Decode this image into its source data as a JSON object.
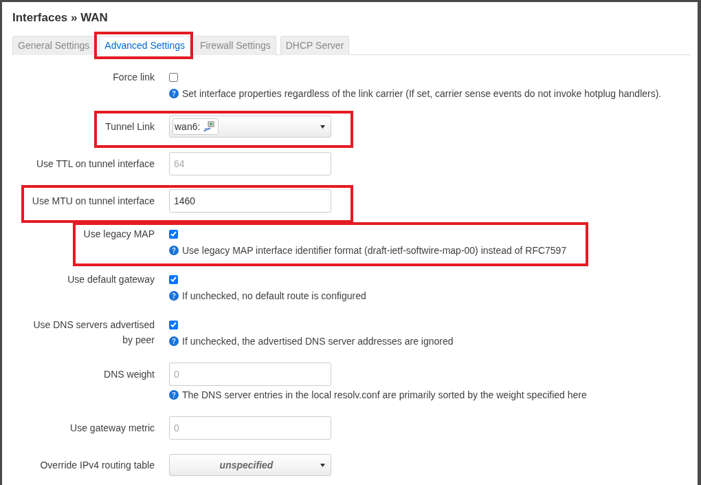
{
  "title": "Interfaces » WAN",
  "tabs": [
    {
      "label": "General Settings",
      "selected": false,
      "highlighted": false
    },
    {
      "label": "Advanced Settings",
      "selected": true,
      "highlighted": true
    },
    {
      "label": "Firewall Settings",
      "selected": false,
      "highlighted": false
    },
    {
      "label": "DHCP Server",
      "selected": false,
      "highlighted": false
    }
  ],
  "fields": [
    {
      "label": "Force link",
      "kind": "checkbox",
      "checked": false,
      "highlighted": false,
      "help": "Set interface properties regardless of the link carrier (If set, carrier sense events do not invoke hotplug handlers)."
    },
    {
      "label": "Tunnel Link",
      "kind": "select",
      "chip": "wan6:",
      "highlighted": true
    },
    {
      "label": "Use TTL on tunnel interface",
      "kind": "text",
      "placeholder": "64",
      "highlighted": false
    },
    {
      "label": "Use MTU on tunnel interface",
      "kind": "text",
      "value": "1460",
      "highlighted": true
    },
    {
      "label": "Use legacy MAP",
      "kind": "checkbox",
      "checked": true,
      "highlighted": true,
      "help": "Use legacy MAP interface identifier format (draft-ietf-softwire-map-00) instead of RFC7597"
    },
    {
      "label": "Use default gateway",
      "kind": "checkbox",
      "checked": true,
      "highlighted": false,
      "help": "If unchecked, no default route is configured"
    },
    {
      "label": "Use DNS servers advertised by peer",
      "kind": "checkbox",
      "checked": true,
      "highlighted": false,
      "help": "If unchecked, the advertised DNS server addresses are ignored"
    },
    {
      "label": "DNS weight",
      "kind": "text",
      "placeholder": "0",
      "highlighted": false,
      "help": "The DNS server entries in the local resolv.conf are primarily sorted by the weight specified here"
    },
    {
      "label": "Use gateway metric",
      "kind": "text",
      "placeholder": "0",
      "highlighted": false
    },
    {
      "label": "Override IPv4 routing table",
      "kind": "select",
      "value": "unspecified",
      "highlighted": false
    }
  ]
}
